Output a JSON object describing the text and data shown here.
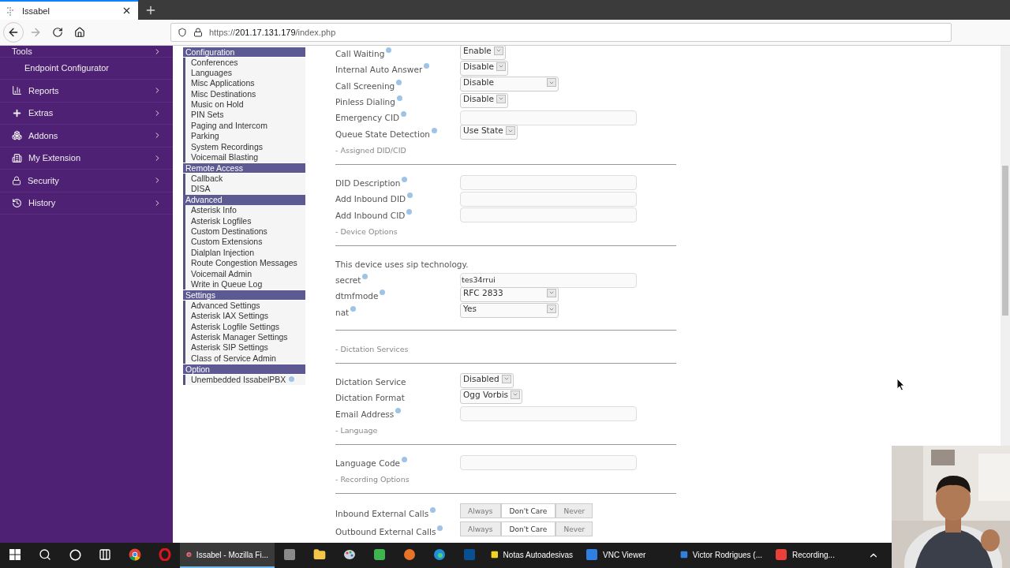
{
  "browser": {
    "tab_title": "Issabel",
    "url_prefix": "https://",
    "url_host": "201.17.131.179",
    "url_path": "/index.php"
  },
  "sidebar": {
    "items": [
      {
        "label": "Tools",
        "kind": "menu"
      },
      {
        "label": "Endpoint Configurator",
        "kind": "subitem"
      },
      {
        "label": "Reports",
        "kind": "menu"
      },
      {
        "label": "Extras",
        "kind": "menu"
      },
      {
        "label": "Addons",
        "kind": "menu"
      },
      {
        "label": "My Extension",
        "kind": "menu"
      },
      {
        "label": "Security",
        "kind": "menu"
      },
      {
        "label": "History",
        "kind": "menu"
      }
    ]
  },
  "module_menu": {
    "groups": [
      {
        "header": "Configuration",
        "items": [
          {
            "label": "Conferences",
            "help": false
          },
          {
            "label": "Languages",
            "help": false
          },
          {
            "label": "Misc Applications",
            "help": false
          },
          {
            "label": "Misc Destinations",
            "help": false
          },
          {
            "label": "Music on Hold",
            "help": false
          },
          {
            "label": "PIN Sets",
            "help": false
          },
          {
            "label": "Paging and Intercom",
            "help": false
          },
          {
            "label": "Parking",
            "help": false
          },
          {
            "label": "System Recordings",
            "help": false
          },
          {
            "label": "Voicemail Blasting",
            "help": false
          }
        ]
      },
      {
        "header": "Remote Access",
        "items": [
          {
            "label": "Callback",
            "help": false
          },
          {
            "label": "DISA",
            "help": false
          }
        ]
      },
      {
        "header": "Advanced",
        "items": [
          {
            "label": "Asterisk Info",
            "help": false
          },
          {
            "label": "Asterisk Logfiles",
            "help": false
          },
          {
            "label": "Custom Destinations",
            "help": false
          },
          {
            "label": "Custom Extensions",
            "help": false
          },
          {
            "label": "Dialplan Injection",
            "help": false
          },
          {
            "label": "Route Congestion Messages",
            "help": false
          },
          {
            "label": "Voicemail Admin",
            "help": false
          },
          {
            "label": "Write in Queue Log",
            "help": false
          }
        ]
      },
      {
        "header": "Settings",
        "items": [
          {
            "label": "Advanced Settings",
            "help": false
          },
          {
            "label": "Asterisk IAX Settings",
            "help": false
          },
          {
            "label": "Asterisk Logfile Settings",
            "help": false
          },
          {
            "label": "Asterisk Manager Settings",
            "help": false
          },
          {
            "label": "Asterisk SIP Settings",
            "help": false
          },
          {
            "label": "Class of Service Admin",
            "help": false
          }
        ]
      },
      {
        "header": "Option",
        "items": [
          {
            "label": "Unembedded IssabelPBX",
            "help": true
          }
        ]
      }
    ]
  },
  "form": {
    "rows": [
      {
        "kind": "select",
        "label": "Call Waiting",
        "help": true,
        "value": "Enable",
        "wide": false
      },
      {
        "kind": "select",
        "label": "Internal Auto Answer",
        "help": true,
        "value": "Disable",
        "wide": false
      },
      {
        "kind": "select",
        "label": "Call Screening",
        "help": true,
        "value": "Disable",
        "wide": true
      },
      {
        "kind": "select",
        "label": "Pinless Dialing",
        "help": true,
        "value": "Disable",
        "wide": false
      },
      {
        "kind": "text",
        "label": "Emergency CID",
        "help": true
      },
      {
        "kind": "select",
        "label": "Queue State Detection",
        "help": true,
        "value": "Use State",
        "wide": false
      },
      {
        "kind": "section",
        "label": "- Assigned DID/CID"
      },
      {
        "kind": "text",
        "label": "DID Description",
        "help": true
      },
      {
        "kind": "text",
        "label": "Add Inbound DID",
        "help": true
      },
      {
        "kind": "text",
        "label": "Add Inbound CID",
        "help": true
      },
      {
        "kind": "section",
        "label": "- Device Options"
      },
      {
        "kind": "note",
        "label": "This device uses sip technology."
      },
      {
        "kind": "text",
        "label": "secret",
        "help": true,
        "value": "tes34rrui"
      },
      {
        "kind": "select",
        "label": "dtmfmode",
        "help": true,
        "value": "RFC 2833",
        "wide": true
      },
      {
        "kind": "select",
        "label": "nat",
        "help": true,
        "value": "Yes",
        "wide": true
      },
      {
        "kind": "divider"
      },
      {
        "kind": "section",
        "label": "- Dictation Services"
      },
      {
        "kind": "select",
        "label": "Dictation Service",
        "help": false,
        "value": "Disabled",
        "wide": false
      },
      {
        "kind": "select",
        "label": "Dictation Format",
        "help": false,
        "value": "Ogg Vorbis",
        "wide": false
      },
      {
        "kind": "text",
        "label": "Email Address",
        "help": true
      },
      {
        "kind": "section",
        "label": "- Language"
      },
      {
        "kind": "text",
        "label": "Language Code",
        "help": true
      },
      {
        "kind": "section",
        "label": "- Recording Options"
      },
      {
        "kind": "radio",
        "label": "Inbound External Calls",
        "help": true,
        "options": [
          {
            "label": "Always",
            "selected": false
          },
          {
            "label": "Don't Care",
            "selected": true
          },
          {
            "label": "Never",
            "selected": false
          }
        ]
      },
      {
        "kind": "radio",
        "label": "Outbound External Calls",
        "help": true,
        "options": [
          {
            "label": "Always",
            "selected": false
          },
          {
            "label": "Don't Care",
            "selected": true
          },
          {
            "label": "Never",
            "selected": false
          }
        ]
      }
    ]
  },
  "taskbar": {
    "items": [
      {
        "kind": "icon",
        "selected": false
      },
      {
        "kind": "icon",
        "selected": false
      },
      {
        "kind": "icon",
        "selected": false
      },
      {
        "kind": "icon",
        "selected": false
      },
      {
        "kind": "icon",
        "selected": false
      },
      {
        "kind": "icon",
        "selected": false
      },
      {
        "kind": "app",
        "label": "Issabel - Mozilla Fi...",
        "selected": true
      },
      {
        "kind": "icon",
        "selected": false
      },
      {
        "kind": "icon",
        "selected": false
      },
      {
        "kind": "icon",
        "selected": false
      },
      {
        "kind": "icon",
        "selected": false
      },
      {
        "kind": "icon",
        "selected": false
      },
      {
        "kind": "icon",
        "selected": false
      },
      {
        "kind": "icon",
        "selected": false
      },
      {
        "kind": "app",
        "label": "Notas Autoadesivas",
        "selected": false
      },
      {
        "kind": "app",
        "label": "VNC Viewer",
        "selected": false
      },
      {
        "kind": "app",
        "label": "Victor Rodrigues (...",
        "selected": false
      },
      {
        "kind": "app",
        "label": "Recording...",
        "selected": false
      }
    ]
  }
}
